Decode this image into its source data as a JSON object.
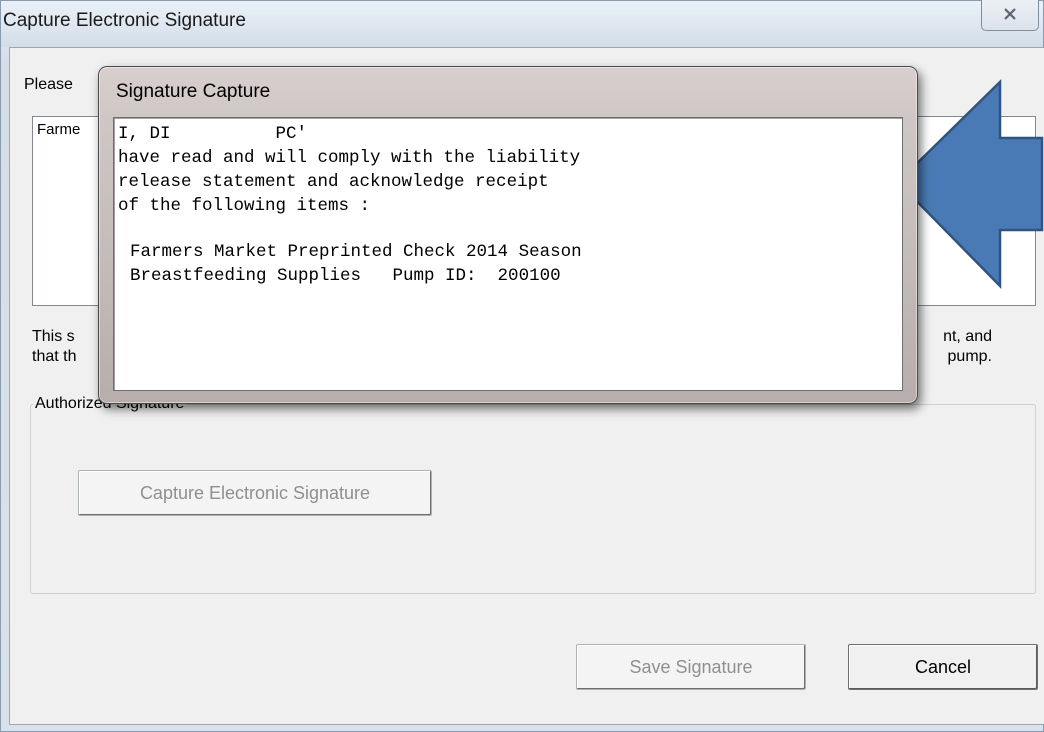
{
  "main_window": {
    "title": "Capture Electronic Signature",
    "instruction_text": "Please",
    "items_box_text": "Farme",
    "statement_line1_start": "This s",
    "statement_line1_end": "nt, and",
    "statement_line2_start": "that th",
    "statement_line2_end": "pump.",
    "group_label": "Authorized Signature",
    "capture_button_label": "Capture Electronic Signature",
    "save_button_label": "Save Signature",
    "cancel_button_label": "Cancel",
    "close_icon": "close-icon"
  },
  "signature_popup": {
    "title": "Signature Capture",
    "lines": [
      "I, DI          PC'",
      "have read and will comply with the liability",
      "release statement and acknowledge receipt",
      "of the following items :",
      "Farmers Market Preprinted Check 2014 Season",
      "Breastfeeding Supplies   Pump ID:  200100"
    ]
  },
  "annotation": {
    "arrow_icon": "left-arrow-icon",
    "arrow_color": "#4a7ab5"
  }
}
